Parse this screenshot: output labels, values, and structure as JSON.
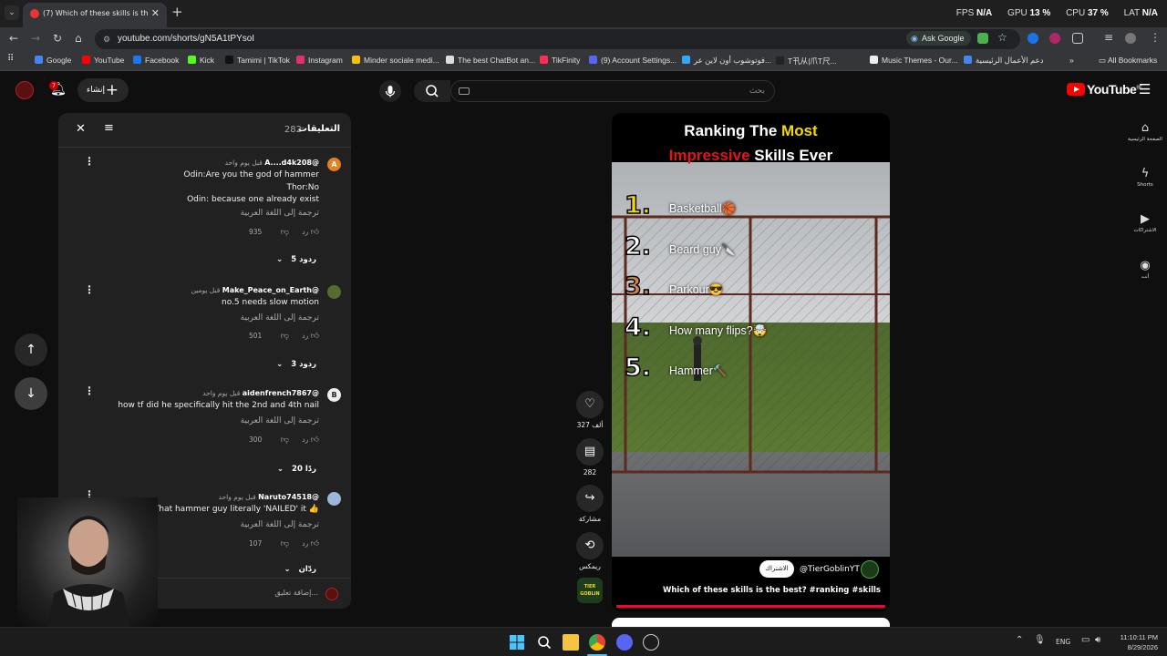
{
  "browser": {
    "tab_title": "(7) Which of these skills is th",
    "url": "youtube.com/shorts/gN5A1tPYsoI",
    "ask_google": "Ask Google",
    "perf": {
      "fps_label": "FPS",
      "fps": "N/A",
      "gpu_label": "GPU",
      "gpu": "13 %",
      "cpu_label": "CPU",
      "cpu": "37 %",
      "lat_label": "LAT",
      "lat": "N/A"
    },
    "bookmarks": [
      {
        "label": "Google",
        "color": "#4285f4"
      },
      {
        "label": "YouTube",
        "color": "#ff0000"
      },
      {
        "label": "Facebook",
        "color": "#1877f2"
      },
      {
        "label": "Kick",
        "color": "#53fc18"
      },
      {
        "label": "Tamimi | TikTok",
        "color": "#111111"
      },
      {
        "label": "Instagram",
        "color": "#e1306c"
      },
      {
        "label": "Minder sociale medi...",
        "color": "#f4c20d"
      },
      {
        "label": "The best ChatBot an...",
        "color": "#dddddd"
      },
      {
        "label": "TikFinity",
        "color": "#ff2d55"
      },
      {
        "label": "(9) Account Settings...",
        "color": "#5865f2"
      },
      {
        "label": "فوتوشوب أون لاين عر...",
        "color": "#31a8ff"
      },
      {
        "label": "T卂从|爪T尺...",
        "color": "#222222"
      },
      {
        "label": "Music Themes - Our...",
        "color": "#eeeeee"
      },
      {
        "label": "دعم الأعمال الرئيسية",
        "color": "#4285f4"
      }
    ],
    "all_bookmarks": "All Bookmarks"
  },
  "youtube": {
    "create_label": "إنشاء",
    "notification_count": "7",
    "search_placeholder": "بحث",
    "logo": "YouTube",
    "logo_region": "BE",
    "sidebar": [
      {
        "label": "الصفحة الرئيسية",
        "icon": "home-icon",
        "glyph": "⌂"
      },
      {
        "label": "Shorts",
        "icon": "shorts-icon",
        "glyph": "ϟ"
      },
      {
        "label": "الاشتراكات",
        "icon": "subscriptions-icon",
        "glyph": "▶"
      },
      {
        "label": "أنت",
        "icon": "you-icon",
        "glyph": "◉"
      }
    ]
  },
  "comments": {
    "title": "التعليقات",
    "count": "282",
    "add_placeholder": "إضافة تعليق...",
    "items": [
      {
        "author": "@A....d4k208",
        "time": "قبل يوم واحد",
        "lines": [
          "Odin:Are you the god of hammer",
          "Thor:No",
          "Odin: because one already exist"
        ],
        "translate": "ترجمة إلى اللغة العربية",
        "likes": "935",
        "reply": "رد",
        "replies": "5 ردود",
        "avatar": "A",
        "avatar_color": "#e67e22"
      },
      {
        "author": "@Make_Peace_on_Earth",
        "time": "قبل يومين",
        "lines": [
          "no.5 needs slow motion"
        ],
        "translate": "ترجمة إلى اللغة العربية",
        "likes": "501",
        "reply": "رد",
        "replies": "3 ردود",
        "avatar": "",
        "avatar_color": "#556b2f"
      },
      {
        "author": "@aidenfrench7867",
        "time": "قبل يوم واحد",
        "lines": [
          "how tf did he specifically hit the 2nd and 4th nail"
        ],
        "translate": "ترجمة إلى اللغة العربية",
        "likes": "300",
        "reply": "رد",
        "replies": "20 ردًا",
        "avatar": "B",
        "avatar_color": "#eeeeee"
      },
      {
        "author": "@Naruto74518",
        "time": "قبل يوم واحد",
        "lines": [
          "That hammer guy literally 'NAILED' it 👍"
        ],
        "translate": "ترجمة إلى اللغة العربية",
        "likes": "107",
        "reply": "رد",
        "replies": "ردّان",
        "avatar": "",
        "avatar_color": "#9db7d8"
      }
    ]
  },
  "video": {
    "title_line1_a": "Ranking The ",
    "title_line1_b": "Most",
    "title_line2_a": "Impressive",
    "title_line2_b": " Skills Ever",
    "ranks": [
      {
        "num": "1.",
        "label": "Basketball🏀",
        "color": "#f5d90a"
      },
      {
        "num": "2.",
        "label": "Beard guy🔪",
        "color": "#ffffff"
      },
      {
        "num": "3.",
        "label": "Parkour😎",
        "color": "#c8894a"
      },
      {
        "num": "4.",
        "label": "How many flips?🤯",
        "color": "#ffffff"
      },
      {
        "num": "5.",
        "label": "Hammer🔨",
        "color": "#ffffff"
      }
    ],
    "channel": "@TierGoblinYT",
    "subscribe": "الاشتراك",
    "caption": "Which of these skills is the best? #ranking #skills",
    "actions": {
      "likes": "327 ألف",
      "comments": "282",
      "share": "مشاركة",
      "remix": "ريمكس"
    },
    "channel_badge": "TIER GOBLIN"
  },
  "taskbar": {
    "lang": "ENG",
    "time": "11:10:11 PM",
    "date": "8/29/2026"
  }
}
